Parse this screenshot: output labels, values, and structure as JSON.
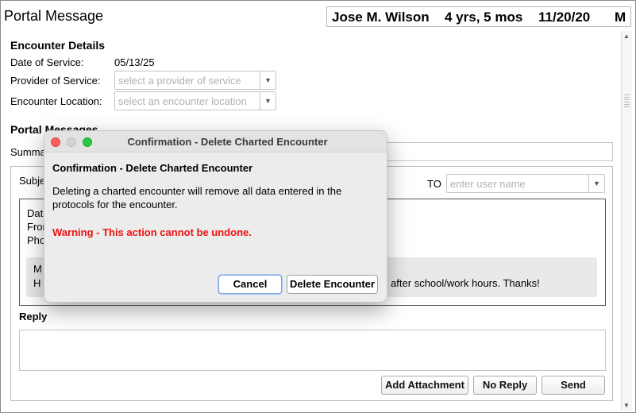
{
  "window": {
    "title": "Portal Message"
  },
  "patient": {
    "name": "Jose M. Wilson",
    "age": "4 yrs, 5 mos",
    "dob": "11/20/20",
    "sex": "M"
  },
  "encounter": {
    "heading": "Encounter Details",
    "date_label": "Date of Service:",
    "date_value": "05/13/25",
    "provider_label": "Provider of Service:",
    "provider_placeholder": "select a provider of service",
    "location_label": "Encounter Location:",
    "location_placeholder": "select an encounter location"
  },
  "portal": {
    "heading": "Portal Messages",
    "summary_label": "Summary",
    "subject_label": "Subject",
    "to_label": "TO",
    "to_placeholder": "enter user name",
    "msg_date_label": "Date",
    "msg_from_label": "From",
    "msg_phone_label": "Phone",
    "msg_line1": "M",
    "msg_line2_start": "H",
    "msg_line2_end": "ed after school/work hours. Thanks!",
    "reply_label": "Reply"
  },
  "buttons": {
    "add_attachment": "Add Attachment",
    "no_reply": "No Reply",
    "send": "Send"
  },
  "dialog": {
    "title": "Confirmation - Delete Charted Encounter",
    "heading": "Confirmation - Delete Charted Encounter",
    "body": "Deleting a charted encounter will remove all data entered in the protocols for the encounter.",
    "warning": "Warning - This action cannot be undone.",
    "cancel": "Cancel",
    "delete": "Delete Encounter",
    "warning_color": "#ee1111"
  }
}
